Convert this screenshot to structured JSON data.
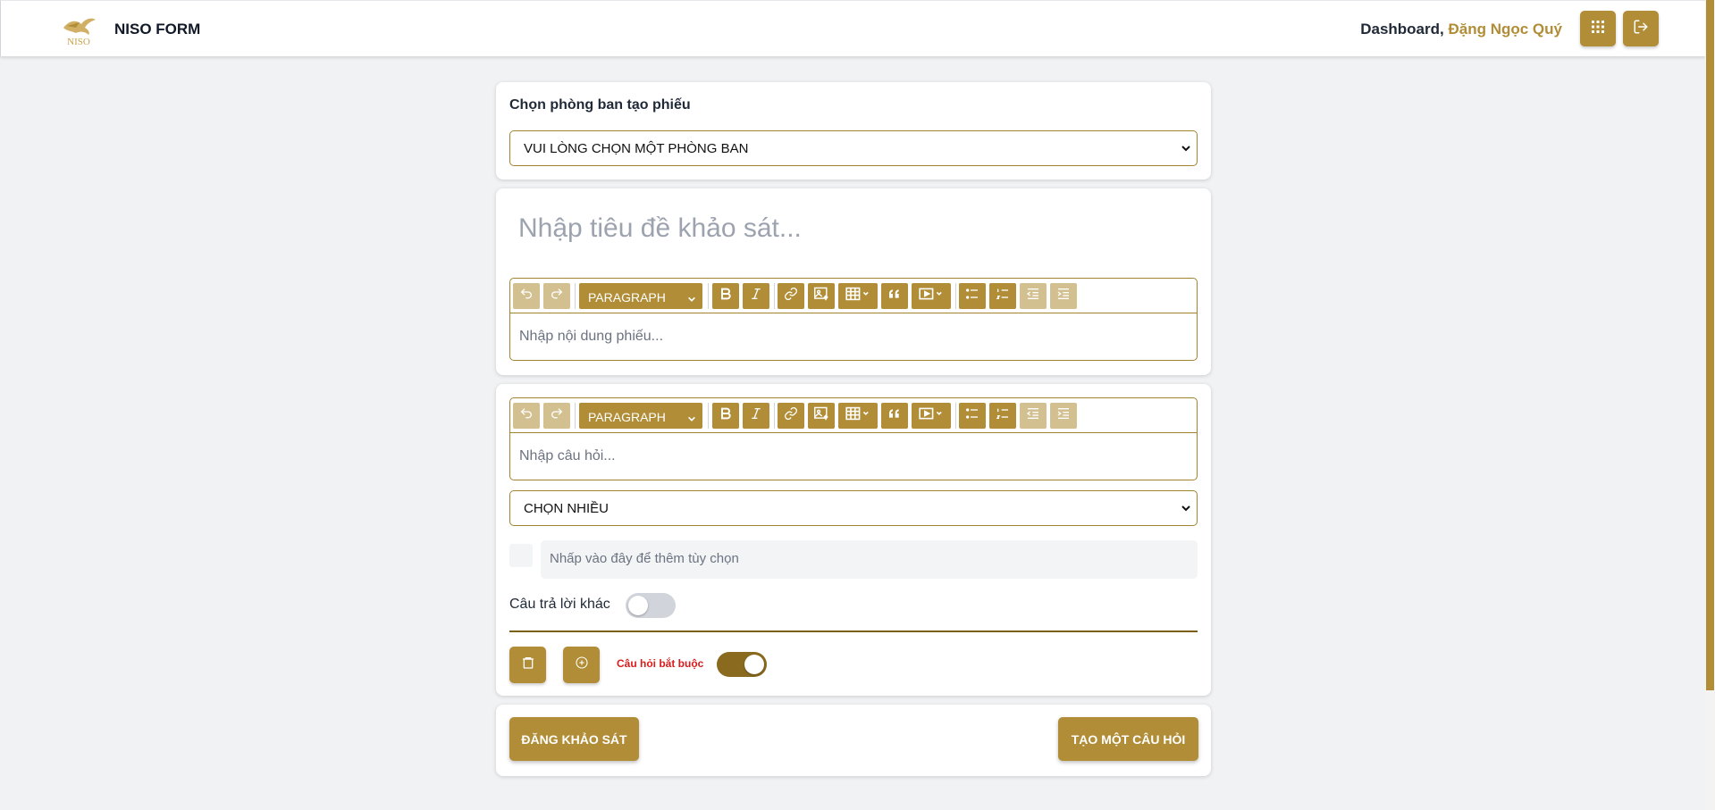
{
  "header": {
    "brand": "NISO FORM",
    "logo_text": "NISO",
    "greeting": "Dashboard,",
    "user_name": "Đặng Ngọc Quý",
    "apps_icon": "grid-icon",
    "logout_icon": "logout-icon"
  },
  "department": {
    "label": "Chọn phòng ban tạo phiếu",
    "selected": "VUI LÒNG CHỌN MỘT PHÒNG BAN"
  },
  "survey": {
    "title_placeholder": "Nhập tiêu đề khảo sát...",
    "content_placeholder": "Nhập nội dung phiếu..."
  },
  "toolbar": {
    "block_type": "PARAGRAPH"
  },
  "question": {
    "placeholder": "Nhập câu hỏi...",
    "type_selected": "CHỌN NHIỀU",
    "option_placeholder": "Nhấp vào đây để thêm tùy chọn",
    "other_answer_label": "Câu trả lời khác",
    "other_answer_enabled": false,
    "required_label": "Câu hỏi bắt buộc",
    "required_enabled": true
  },
  "actions": {
    "publish": "ĐĂNG KHẢO SÁT",
    "add_question": "TẠO MỘT CÂU HỎI"
  },
  "colors": {
    "accent": "#b08d36",
    "accent_dark": "#8a6a1e",
    "required": "#d91c1c"
  }
}
